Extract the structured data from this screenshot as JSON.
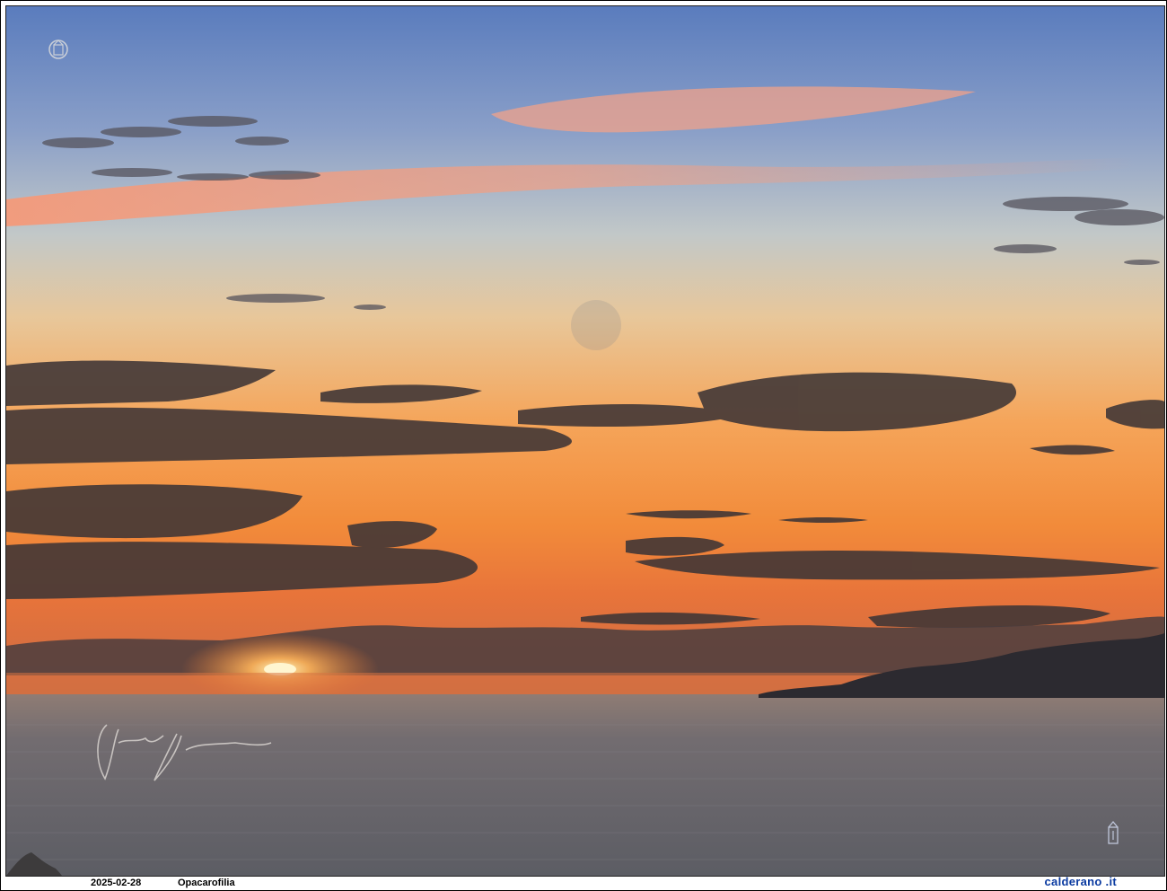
{
  "photo": {
    "description_icons": {
      "top_left_logo": "crest-logo-icon",
      "bottom_right_logo": "crest-logo-icon",
      "signature": "handwritten-signature"
    },
    "colors": {
      "sky_top": "#5d7fbd",
      "sky_mid": "#b9c2c8",
      "sky_horizon": "#f08a3a",
      "sun": "#fff2b0",
      "sea": "#6b6a6f",
      "clouds": "#3e3535",
      "headland": "#2c2a30"
    }
  },
  "footer": {
    "date": "2025-02-28",
    "caption": "Opacarofilia",
    "site": "calderano .it"
  }
}
